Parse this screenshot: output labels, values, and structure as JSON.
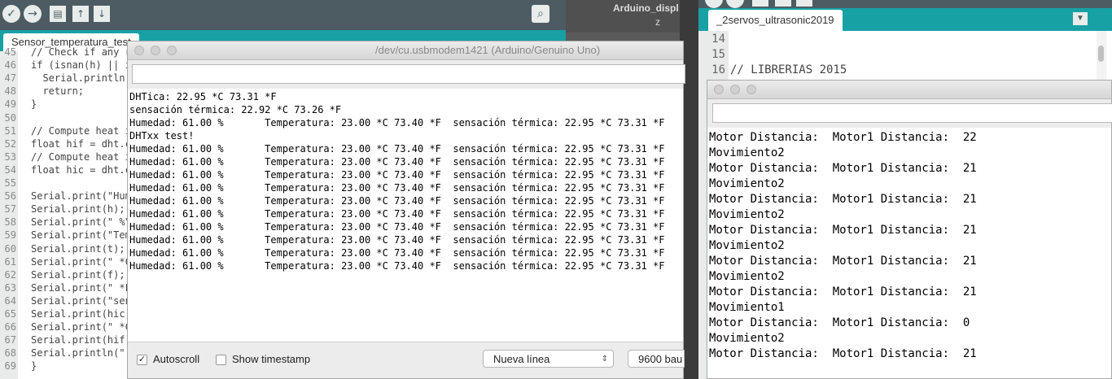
{
  "left_ide": {
    "tab_label": "Sensor_temperatura_test",
    "toolbar_icons": [
      "verify-icon",
      "upload-icon",
      "new-icon",
      "open-icon",
      "save-icon",
      "serial-monitor-icon"
    ],
    "code_lines": [
      {
        "n": "45",
        "t": "// Check if any r"
      },
      {
        "n": "46",
        "t": "if (isnan(h) || i"
      },
      {
        "n": "47",
        "t": "  Serial.println("
      },
      {
        "n": "48",
        "t": "  return;"
      },
      {
        "n": "49",
        "t": "}"
      },
      {
        "n": "50",
        "t": ""
      },
      {
        "n": "51",
        "t": "// Compute heat i"
      },
      {
        "n": "52",
        "t": "float hif = dht.c"
      },
      {
        "n": "53",
        "t": "// Compute heat i"
      },
      {
        "n": "54",
        "t": "float hic = dht.c"
      },
      {
        "n": "55",
        "t": ""
      },
      {
        "n": "56",
        "t": "Serial.print(\"Hum"
      },
      {
        "n": "57",
        "t": "Serial.print(h);"
      },
      {
        "n": "58",
        "t": "Serial.print(\" %\\"
      },
      {
        "n": "59",
        "t": "Serial.print(\"Tem"
      },
      {
        "n": "60",
        "t": "Serial.print(t);"
      },
      {
        "n": "61",
        "t": "Serial.print(\" *C"
      },
      {
        "n": "62",
        "t": "Serial.print(f);"
      },
      {
        "n": "63",
        "t": "Serial.print(\" *F"
      },
      {
        "n": "64",
        "t": "Serial.print(\"sen"
      },
      {
        "n": "65",
        "t": "Serial.print(hic)"
      },
      {
        "n": "66",
        "t": "Serial.print(\" *C"
      },
      {
        "n": "67",
        "t": "Serial.print(hif)"
      },
      {
        "n": "68",
        "t": "Serial.println(\""
      },
      {
        "n": "69",
        "t": "}"
      }
    ]
  },
  "bg_window": {
    "title": "Arduino_displ",
    "subtitle": "z"
  },
  "serial1": {
    "title": "/dev/cu.usbmodem1421 (Arduino/Genuino Uno)",
    "input_value": "",
    "lines": [
      "DHTica: 22.95 *C 73.31 *F",
      "sensación térmica: 22.92 *C 73.26 *F",
      "Humedad: 61.00 %       Temperatura: 23.00 *C 73.40 *F  sensación térmica: 22.95 *C 73.31 *F",
      "DHTxx test!",
      "Humedad: 61.00 %       Temperatura: 23.00 *C 73.40 *F  sensación térmica: 22.95 *C 73.31 *F",
      "Humedad: 61.00 %       Temperatura: 23.00 *C 73.40 *F  sensación térmica: 22.95 *C 73.31 *F",
      "Humedad: 61.00 %       Temperatura: 23.00 *C 73.40 *F  sensación térmica: 22.95 *C 73.31 *F",
      "Humedad: 61.00 %       Temperatura: 23.00 *C 73.40 *F  sensación térmica: 22.95 *C 73.31 *F",
      "Humedad: 61.00 %       Temperatura: 23.00 *C 73.40 *F  sensación térmica: 22.95 *C 73.31 *F",
      "Humedad: 61.00 %       Temperatura: 23.00 *C 73.40 *F  sensación térmica: 22.95 *C 73.31 *F",
      "Humedad: 61.00 %       Temperatura: 23.00 *C 73.40 *F  sensación térmica: 22.95 *C 73.31 *F",
      "Humedad: 61.00 %       Temperatura: 23.00 *C 73.40 *F  sensación térmica: 22.95 *C 73.31 *F",
      "Humedad: 61.00 %       Temperatura: 23.00 *C 73.40 *F  sensación térmica: 22.95 *C 73.31 *F",
      "Humedad: 61.00 %       Temperatura: 23.00 *C 73.40 *F  sensación térmica: 22.95 *C 73.31 *F"
    ],
    "autoscroll_label": "Autoscroll",
    "autoscroll_checked": true,
    "timestamp_label": "Show timestamp",
    "timestamp_checked": false,
    "line_ending": "Nueva línea",
    "baud": "9600 bau"
  },
  "right_ide": {
    "tab_label": "_2servos_ultrasonic2019",
    "code_lines": [
      {
        "n": "14",
        "t": ""
      },
      {
        "n": "15",
        "t": ""
      },
      {
        "n": "16",
        "t": "// LIBRERIAS 2015"
      }
    ]
  },
  "serial2": {
    "input_value": "",
    "lines": [
      "Motor Distancia:  Motor1 Distancia:  22",
      "Movimiento2",
      "Motor Distancia:  Motor1 Distancia:  21",
      "Movimiento2",
      "Motor Distancia:  Motor1 Distancia:  21",
      "Movimiento2",
      "Motor Distancia:  Motor1 Distancia:  21",
      "Movimiento2",
      "Motor Distancia:  Motor1 Distancia:  21",
      "Movimiento2",
      "Motor Distancia:  Motor1 Distancia:  21",
      "Movimiento1",
      "Motor Distancia:  Motor1 Distancia:  0",
      "Movimiento2",
      "Motor Distancia:  Motor1 Distancia:  21"
    ]
  },
  "colors": {
    "toolbar": "#4d5c63",
    "tabbar": "#17a1a5",
    "gutter": "#e8ebe9"
  }
}
